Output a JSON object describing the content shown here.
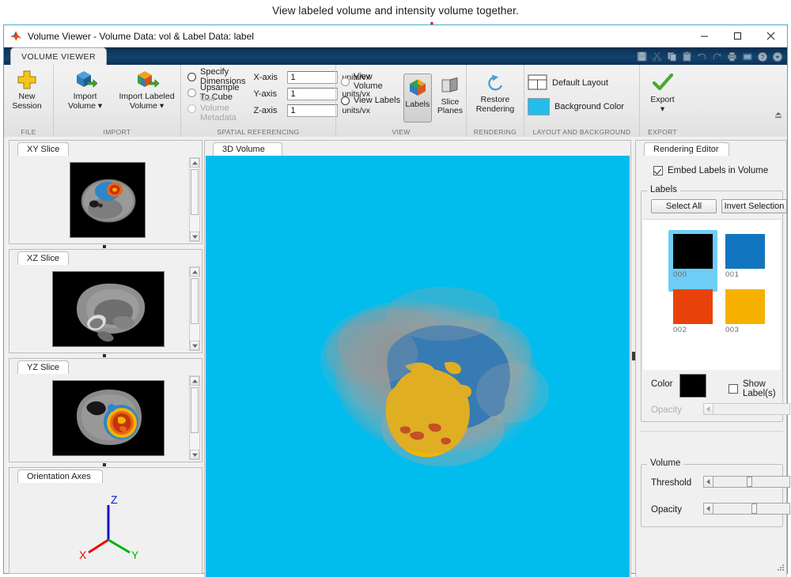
{
  "annotation": {
    "text": "View labeled volume and intensity volume together.",
    "arrow_color": "#cc1111"
  },
  "window": {
    "title": "Volume Viewer - Volume Data: vol & Label Data: label",
    "app_icon": "matlab-icon",
    "controls": {
      "minimize": "–",
      "maximize": "☐",
      "close": "✕"
    }
  },
  "ribbon": {
    "tab": "VOLUME VIEWER",
    "quick_access": [
      "save-icon",
      "cut-icon",
      "copy-icon",
      "paste-icon",
      "undo-icon",
      "redo-icon",
      "print-icon",
      "layout-icon",
      "help-icon",
      "customize-dropdown-icon"
    ],
    "collapse_icon": "collapse-ribbon-icon",
    "groups": [
      {
        "label": "FILE",
        "buttons": [
          {
            "name": "new-session-button",
            "line1": "New",
            "line2": "Session",
            "icon": "plus-icon"
          }
        ]
      },
      {
        "label": "IMPORT",
        "buttons": [
          {
            "name": "import-volume-button",
            "line1": "Import",
            "line2": "Volume ▾",
            "icon": "import-volume-icon"
          },
          {
            "name": "import-labeled-volume-button",
            "line1": "Import Labeled",
            "line2": "Volume ▾",
            "icon": "import-labeled-volume-icon"
          }
        ]
      },
      {
        "label": "SPATIAL REFERENCING",
        "radios": [
          {
            "name": "specify-dimensions-radio",
            "label": "Specify Dimensions",
            "state": "selected"
          },
          {
            "name": "upsample-to-cube-radio",
            "label": "Upsample To Cube",
            "state": "unselected"
          },
          {
            "name": "use-volume-metadata-radio",
            "label": "Use Volume Metadata",
            "state": "disabled"
          }
        ],
        "axes": [
          {
            "label": "X-axis",
            "value": "1",
            "unit": "units/vx"
          },
          {
            "label": "Y-axis",
            "value": "1",
            "unit": "units/vx"
          },
          {
            "label": "Z-axis",
            "value": "1",
            "unit": "units/vx"
          }
        ]
      },
      {
        "label": "VIEW",
        "radios": [
          {
            "name": "view-volume-radio",
            "label": "View Volume",
            "state": "unselected"
          },
          {
            "name": "view-labels-radio",
            "label": "View Labels",
            "state": "selected"
          }
        ],
        "toggles": [
          {
            "name": "labels-toggle-button",
            "label": "Labels",
            "icon": "labeled-cube-icon",
            "pressed": true
          },
          {
            "name": "slice-planes-button",
            "label1": "Slice",
            "label2": "Planes",
            "icon": "slice-planes-icon",
            "pressed": false
          }
        ]
      },
      {
        "label": "RENDERING",
        "buttons": [
          {
            "name": "restore-rendering-button",
            "line1": "Restore",
            "line2": "Rendering",
            "icon": "restore-icon"
          }
        ]
      },
      {
        "label": "LAYOUT AND BACKGROUND",
        "items": [
          {
            "name": "default-layout-button",
            "label": "Default Layout",
            "icon": "layout-grid-icon"
          },
          {
            "name": "background-color-button",
            "label": "Background Color",
            "icon": "color-swatch-icon",
            "color": "#22bdec"
          }
        ]
      },
      {
        "label": "EXPORT",
        "buttons": [
          {
            "name": "export-button",
            "line1": "Export",
            "line2": "▾",
            "icon": "green-check-icon"
          }
        ]
      }
    ]
  },
  "panels": {
    "xy_slice": {
      "tab": "XY Slice"
    },
    "xz_slice": {
      "tab": "XZ Slice"
    },
    "yz_slice": {
      "tab": "YZ Slice"
    },
    "orientation_axes": {
      "tab": "Orientation Axes",
      "axis_labels": {
        "x": "X",
        "y": "Y",
        "z": "Z"
      },
      "axis_colors": {
        "x": "#ee0000",
        "y": "#00b400",
        "z": "#1111cc"
      }
    },
    "volume_3d": {
      "tab": "3D Volume",
      "background_color": "#00bdee"
    }
  },
  "rendering_editor": {
    "tab": "Rendering Editor",
    "embed_labels_checkbox": {
      "label": "Embed Labels in Volume",
      "checked": true
    },
    "labels_group": {
      "title": "Labels",
      "select_all_button": "Select All",
      "invert_selection_button": "Invert Selection",
      "items": [
        {
          "caption": "000",
          "color": "#000000",
          "selected": true
        },
        {
          "caption": "001",
          "color": "#1175bf",
          "selected": false
        },
        {
          "caption": "002",
          "color": "#e8420a",
          "selected": false
        },
        {
          "caption": "003",
          "color": "#f6b100",
          "selected": false
        }
      ],
      "color_label": "Color",
      "current_color": "#000000",
      "show_labels_checkbox": {
        "label": "Show Label(s)",
        "checked": false
      },
      "opacity_label": "Opacity",
      "opacity_enabled": false,
      "opacity_value": 0
    },
    "volume_group": {
      "title": "Volume",
      "threshold_label": "Threshold",
      "threshold_value": 42,
      "opacity_label": "Opacity",
      "opacity_value": 48
    }
  }
}
